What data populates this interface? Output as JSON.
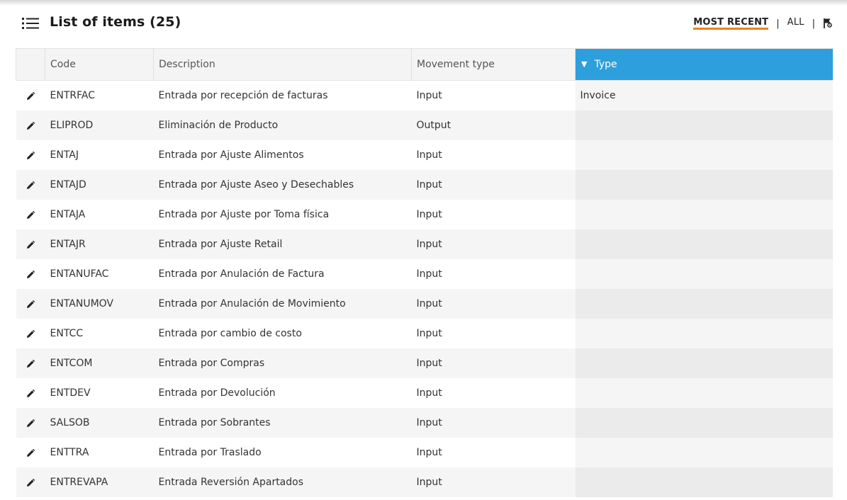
{
  "header": {
    "menu_icon": "list-icon",
    "title": "List of items (25)",
    "filters": {
      "most_recent": "MOST RECENT",
      "separator": "|",
      "all": "ALL",
      "flag_icon": "flag-settings-icon"
    }
  },
  "colors": {
    "accent_orange": "#e8821e",
    "sorted_header": "#2d9fdc"
  },
  "table": {
    "columns": {
      "code": "Code",
      "description": "Description",
      "movement_type": "Movement type",
      "type": "Type"
    },
    "sort_indicator": "▼",
    "rows": [
      {
        "code": "ENTRFAC",
        "description": "Entrada por recepción de facturas",
        "movement_type": "Input",
        "type": "Invoice"
      },
      {
        "code": "ELIPROD",
        "description": "Eliminación de Producto",
        "movement_type": "Output",
        "type": ""
      },
      {
        "code": "ENTAJ",
        "description": "Entrada por Ajuste Alimentos",
        "movement_type": "Input",
        "type": ""
      },
      {
        "code": "ENTAJD",
        "description": "Entrada por Ajuste Aseo y Desechables",
        "movement_type": "Input",
        "type": ""
      },
      {
        "code": "ENTAJA",
        "description": "Entrada por Ajuste por Toma física",
        "movement_type": "Input",
        "type": ""
      },
      {
        "code": "ENTAJR",
        "description": "Entrada por Ajuste Retail",
        "movement_type": "Input",
        "type": ""
      },
      {
        "code": "ENTANUFAC",
        "description": "Entrada por Anulación de Factura",
        "movement_type": "Input",
        "type": ""
      },
      {
        "code": "ENTANUMOV",
        "description": "Entrada por Anulación de Movimiento",
        "movement_type": "Input",
        "type": ""
      },
      {
        "code": "ENTCC",
        "description": "Entrada por cambio de costo",
        "movement_type": "Input",
        "type": ""
      },
      {
        "code": "ENTCOM",
        "description": "Entrada por Compras",
        "movement_type": "Input",
        "type": ""
      },
      {
        "code": "ENTDEV",
        "description": "Entrada por Devolución",
        "movement_type": "Input",
        "type": ""
      },
      {
        "code": "SALSOB",
        "description": "Entrada por Sobrantes",
        "movement_type": "Input",
        "type": ""
      },
      {
        "code": "ENTTRA",
        "description": "Entrada por Traslado",
        "movement_type": "Input",
        "type": ""
      },
      {
        "code": "ENTREVAPA",
        "description": "Entrada Reversión Apartados",
        "movement_type": "Input",
        "type": ""
      }
    ]
  }
}
